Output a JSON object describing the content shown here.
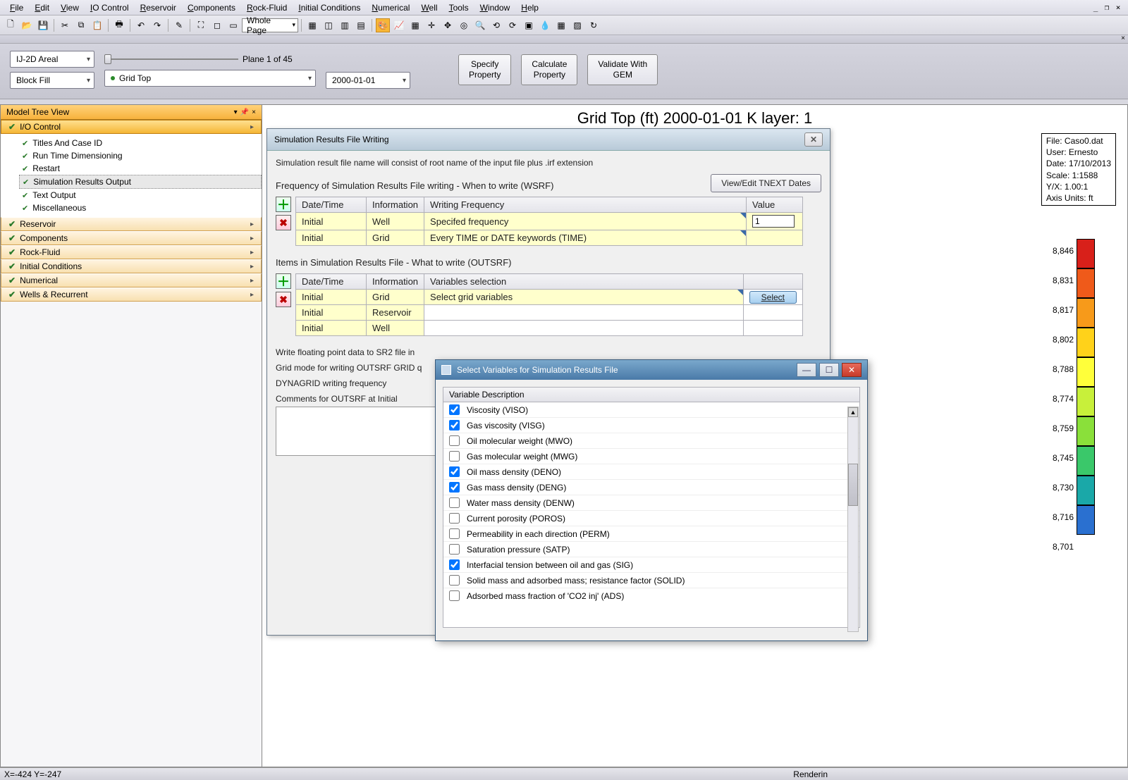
{
  "menubar": [
    "File",
    "Edit",
    "View",
    "IO Control",
    "Reservoir",
    "Components",
    "Rock-Fluid",
    "Initial Conditions",
    "Numerical",
    "Well",
    "Tools",
    "Window",
    "Help"
  ],
  "toolbar": {
    "zoom": "Whole Page"
  },
  "controls": {
    "view_mode": "IJ-2D Areal",
    "fill_mode": "Block Fill",
    "property": "Grid Top",
    "date": "2000-01-01",
    "plane": "Plane 1 of 45",
    "btn_specify": "Specify\nProperty",
    "btn_calculate": "Calculate\nProperty",
    "btn_validate": "Validate With\nGEM"
  },
  "tree": {
    "title": "Model Tree View",
    "sections": [
      "I/O Control",
      "Reservoir",
      "Components",
      "Rock-Fluid",
      "Initial Conditions",
      "Numerical",
      "Wells & Recurrent"
    ],
    "leaves": [
      "Titles And Case ID",
      "Run Time Dimensioning",
      "Restart",
      "Simulation Results Output",
      "Text Output",
      "Miscellaneous"
    ],
    "selected_leaf": "Simulation Results Output"
  },
  "plot": {
    "title": "Grid Top (ft) 2000-01-01     K layer: 1",
    "info": [
      "File: Caso0.dat",
      "User:  Ernesto",
      "Date: 17/10/2013",
      "Scale: 1:1588",
      "Y/X: 1.00:1",
      "Axis Units: ft"
    ],
    "colorbar_values": [
      "8,846",
      "8,831",
      "8,817",
      "8,802",
      "8,788",
      "8,774",
      "8,759",
      "8,745",
      "8,730",
      "8,716",
      "8,701"
    ],
    "colorbar_colors": [
      "#d8201a",
      "#ef5a1a",
      "#f79a1a",
      "#ffd21a",
      "#ffff3a",
      "#c8f03a",
      "#8ae03a",
      "#3ac86a",
      "#1aa8a8",
      "#2a70d0"
    ]
  },
  "status": {
    "coords": "X=-424 Y=-247",
    "render": "Renderin"
  },
  "dialog1": {
    "title": "Simulation Results File Writing",
    "desc": "Simulation result file name will consist of root name of the input file plus .irf extension",
    "freq_label": "Frequency of Simulation Results File writing -  When to write (WSRF)",
    "btn_tnext": "View/Edit TNEXT Dates",
    "table1_headers": [
      "Date/Time",
      "Information",
      "Writing Frequency",
      "Value"
    ],
    "table1_rows": [
      {
        "dt": "Initial",
        "info": "Well",
        "freq": "Specifed frequency",
        "val": "1"
      },
      {
        "dt": "Initial",
        "info": "Grid",
        "freq": "Every TIME or DATE keywords (TIME)",
        "val": ""
      }
    ],
    "items_label": "Items in Simulation Results File - What to write (OUTSRF)",
    "table2_headers": [
      "Date/Time",
      "Information",
      "Variables selection",
      ""
    ],
    "table2_rows": [
      {
        "dt": "Initial",
        "info": "Grid",
        "sel": "Select grid variables",
        "btn": "Select"
      },
      {
        "dt": "Initial",
        "info": "Reservoir",
        "sel": "",
        "btn": ""
      },
      {
        "dt": "Initial",
        "info": "Well",
        "sel": "",
        "btn": ""
      }
    ],
    "float_label": "Write floating point data to SR2 file in",
    "gridmode_label": "Grid mode for writing OUTSRF GRID q",
    "dynagrid_label": "DYNAGRID writing frequency",
    "comments_label": "Comments for OUTSRF at Initial"
  },
  "dialog2": {
    "title": "Select Variables for Simulation Results File",
    "header": "Variable Description",
    "rows": [
      {
        "c": true,
        "t": "Viscosity (VISO)"
      },
      {
        "c": true,
        "t": "Gas viscosity (VISG)"
      },
      {
        "c": false,
        "t": "Oil molecular weight (MWO)"
      },
      {
        "c": false,
        "t": "Gas molecular weight (MWG)"
      },
      {
        "c": true,
        "t": "Oil mass density (DENO)"
      },
      {
        "c": true,
        "t": "Gas mass density (DENG)"
      },
      {
        "c": false,
        "t": "Water mass density (DENW)"
      },
      {
        "c": false,
        "t": "Current porosity (POROS)"
      },
      {
        "c": false,
        "t": "Permeability in each direction (PERM)"
      },
      {
        "c": false,
        "t": "Saturation pressure (SATP)"
      },
      {
        "c": true,
        "t": "Interfacial tension between oil and gas (SIG)"
      },
      {
        "c": false,
        "t": "Solid mass and adsorbed mass; resistance factor (SOLID)"
      },
      {
        "c": false,
        "t": "Adsorbed mass fraction of 'CO2 inj' (ADS)"
      }
    ]
  }
}
